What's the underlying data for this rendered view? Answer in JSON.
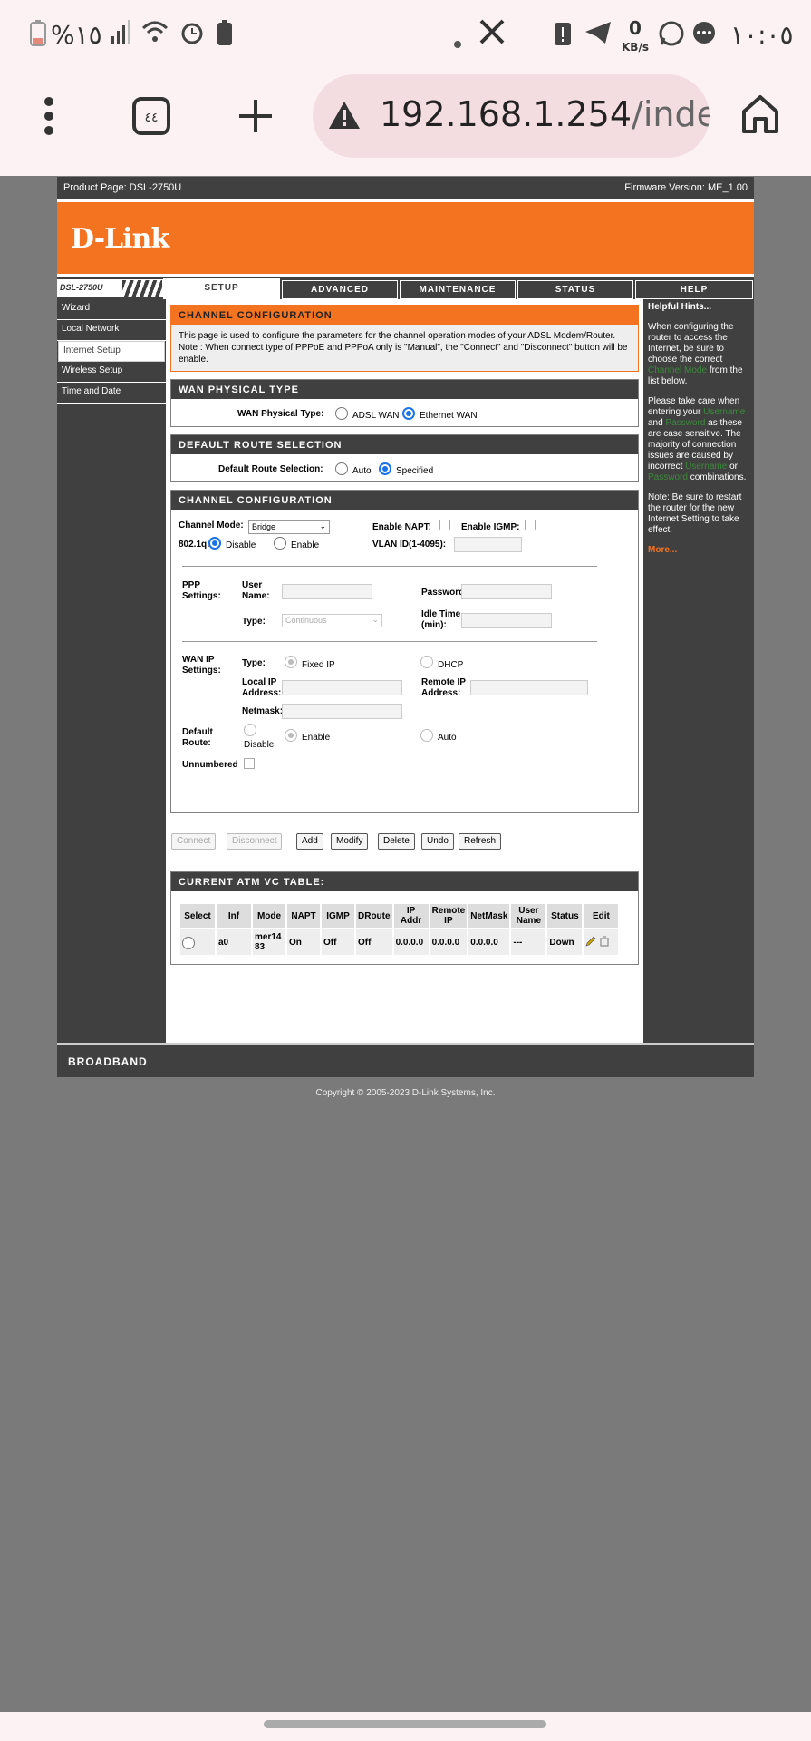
{
  "status_bar": {
    "battery_text": "%١٥",
    "clock": "١٠:٠٥",
    "speed": "0",
    "speed_unit": "KB/s"
  },
  "browser": {
    "url_main": "192.168.1.254",
    "url_path": "/index.h"
  },
  "router": {
    "product_page": "Product Page: DSL-2750U",
    "firmware": "Firmware Version: ME_1.00",
    "logo": "D-Link",
    "model": "DSL-2750U",
    "tabs": [
      "SETUP",
      "ADVANCED",
      "MAINTENANCE",
      "STATUS",
      "HELP"
    ],
    "nav": [
      "Wizard",
      "Local Network",
      "Internet Setup",
      "Wireless Setup",
      "Time and Date"
    ],
    "channel_config": {
      "title": "CHANNEL CONFIGURATION",
      "description": "This page is used to configure the parameters for the channel operation modes of your ADSL Modem/Router. Note : When connect type of PPPoE and PPPoA only is \"Manual\", the \"Connect\" and \"Disconnect\" button will be enable."
    },
    "wan_physical": {
      "title": "WAN PHYSICAL TYPE",
      "label": "WAN Physical Type:",
      "opt1": "ADSL WAN",
      "opt2": "Ethernet WAN"
    },
    "default_route": {
      "title": "DEFAULT ROUTE SELECTION",
      "label": "Default Route Selection:",
      "opt1": "Auto",
      "opt2": "Specified"
    },
    "channel": {
      "title": "CHANNEL CONFIGURATION",
      "channel_mode_label": "Channel Mode:",
      "channel_mode_value": "Bridge",
      "enable_napt": "Enable NAPT:",
      "enable_igmp": "Enable IGMP:",
      "dot1q": "802.1q:",
      "disable": "Disable",
      "enable": "Enable",
      "vlan": "VLAN ID(1-4095):",
      "ppp_settings": "PPP Settings:",
      "user_name": "User Name:",
      "password": "Password:",
      "type": "Type:",
      "type_value": "Continuous",
      "idle_time": "Idle Time (min):",
      "wan_ip_settings": "WAN IP Settings:",
      "fixed_ip": "Fixed IP",
      "dhcp": "DHCP",
      "local_ip": "Local IP Address:",
      "remote_ip": "Remote IP Address:",
      "netmask": "Netmask:",
      "default_route": "Default Route:",
      "auto": "Auto",
      "unnumbered": "Unnumbered"
    },
    "buttons": [
      "Connect",
      "Disconnect",
      "Add",
      "Modify",
      "Delete",
      "Undo",
      "Refresh"
    ],
    "atm": {
      "title": "CURRENT ATM VC TABLE:",
      "headers": [
        "Select",
        "Inf",
        "Mode",
        "NAPT",
        "IGMP",
        "DRoute",
        "IP Addr",
        "Remote IP",
        "NetMask",
        "User Name",
        "Status",
        "Edit"
      ],
      "row": [
        "",
        "a0",
        "mer1483",
        "On",
        "Off",
        "Off",
        "0.0.0.0",
        "0.0.0.0",
        "0.0.0.0",
        "---",
        "Down",
        ""
      ]
    },
    "hints": {
      "title": "Helpful Hints...",
      "p1a": "When configuring the router to access the Internet, be sure to choose the correct",
      "p1b": "Channel Mode",
      "p1c": "from the list below.",
      "p2a": "Please take care when entering your",
      "p2b": "Username",
      "p2c": "and",
      "p2d": "Password",
      "p2e": "as these are case sensitive. The majority of connection issues are caused by incorrect",
      "p2f": "Username",
      "p2g": "or",
      "p2h": "Password",
      "p2i": "combinations.",
      "p3": "Note: Be sure to restart the router for the new Internet Setting to take effect.",
      "more": "More..."
    },
    "footer": "BROADBAND",
    "copyright": "Copyright © 2005-2023 D-Link Systems, Inc."
  },
  "colors": {
    "orange": "#f47320",
    "dark": "#404040",
    "page_bg": "#7a7a7a"
  }
}
